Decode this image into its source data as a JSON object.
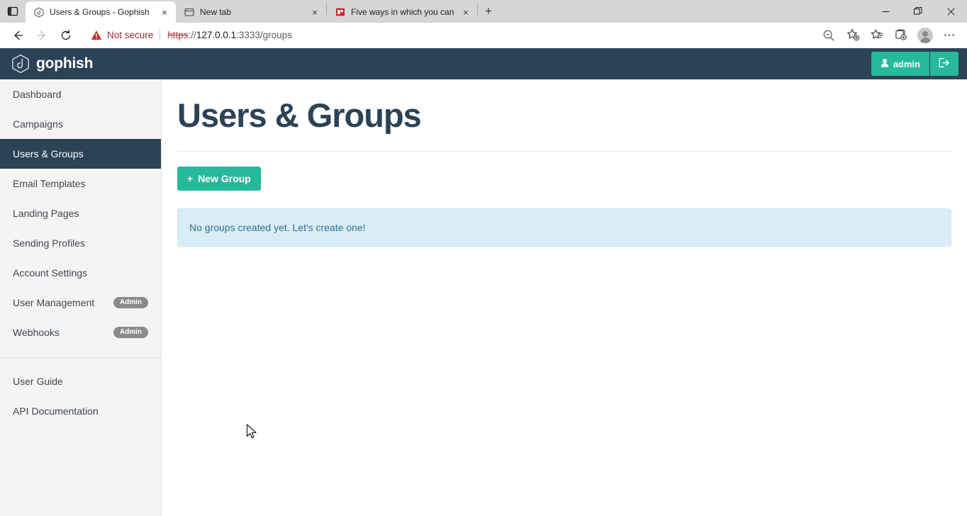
{
  "browser": {
    "tabs": [
      {
        "title": "Users & Groups - Gophish",
        "favicon": "gophish-hexagon-icon",
        "active": true,
        "close_label": "×"
      },
      {
        "title": "New tab",
        "favicon": "new-tab-icon",
        "active": false,
        "close_label": "×"
      },
      {
        "title": "Five ways in which you can comb",
        "favicon": "powerpoint-icon",
        "active": false,
        "close_label": "×"
      }
    ],
    "new_tab_button": "+",
    "sidebar_toggle_icon": "panel-toggle-icon",
    "window_controls": {
      "minimize": "—",
      "restore": "❐",
      "close": "✕"
    },
    "nav": {
      "back_icon": "back-arrow-icon",
      "forward_icon": "forward-arrow-icon",
      "reload_icon": "reload-icon"
    },
    "omnibox": {
      "security_icon": "warning-triangle-icon",
      "security_label": "Not secure",
      "url_scheme": "https",
      "url_separator": "://",
      "url_host": "127.0.0.1",
      "url_rest": ":3333/groups",
      "full_url": "https://127.0.0.1:3333/groups"
    },
    "toolbar_icons": [
      {
        "name": "zoom-out-icon"
      },
      {
        "name": "add-favorite-icon"
      },
      {
        "name": "favorites-icon"
      },
      {
        "name": "collections-icon"
      },
      {
        "name": "profile-avatar-icon"
      },
      {
        "name": "settings-more-icon",
        "glyph": "⋯"
      }
    ]
  },
  "app": {
    "brand": "gophish",
    "logo_icon": "gophish-hexagon-logo",
    "user_button": {
      "label": "admin",
      "icon": "user-icon"
    },
    "logout_button": {
      "icon": "sign-out-icon"
    }
  },
  "sidebar": {
    "items": [
      {
        "label": "Dashboard",
        "active": false,
        "badge": null
      },
      {
        "label": "Campaigns",
        "active": false,
        "badge": null
      },
      {
        "label": "Users & Groups",
        "active": true,
        "badge": null
      },
      {
        "label": "Email Templates",
        "active": false,
        "badge": null
      },
      {
        "label": "Landing Pages",
        "active": false,
        "badge": null
      },
      {
        "label": "Sending Profiles",
        "active": false,
        "badge": null
      },
      {
        "label": "Account Settings",
        "active": false,
        "badge": null
      },
      {
        "label": "User Management",
        "active": false,
        "badge": "Admin"
      },
      {
        "label": "Webhooks",
        "active": false,
        "badge": "Admin"
      }
    ],
    "footer_items": [
      {
        "label": "User Guide"
      },
      {
        "label": "API Documentation"
      }
    ]
  },
  "main": {
    "page_title": "Users & Groups",
    "new_group_button": {
      "label": "New Group",
      "plus": "+"
    },
    "empty_alert": "No groups created yet. Let's create one!"
  },
  "colors": {
    "navy": "#2b4257",
    "green": "#27b99b",
    "alert_bg": "#d9edf7",
    "alert_text": "#31708f",
    "sidebar_bg": "#f4f4f4",
    "badge_gray": "#8a8a8a"
  }
}
